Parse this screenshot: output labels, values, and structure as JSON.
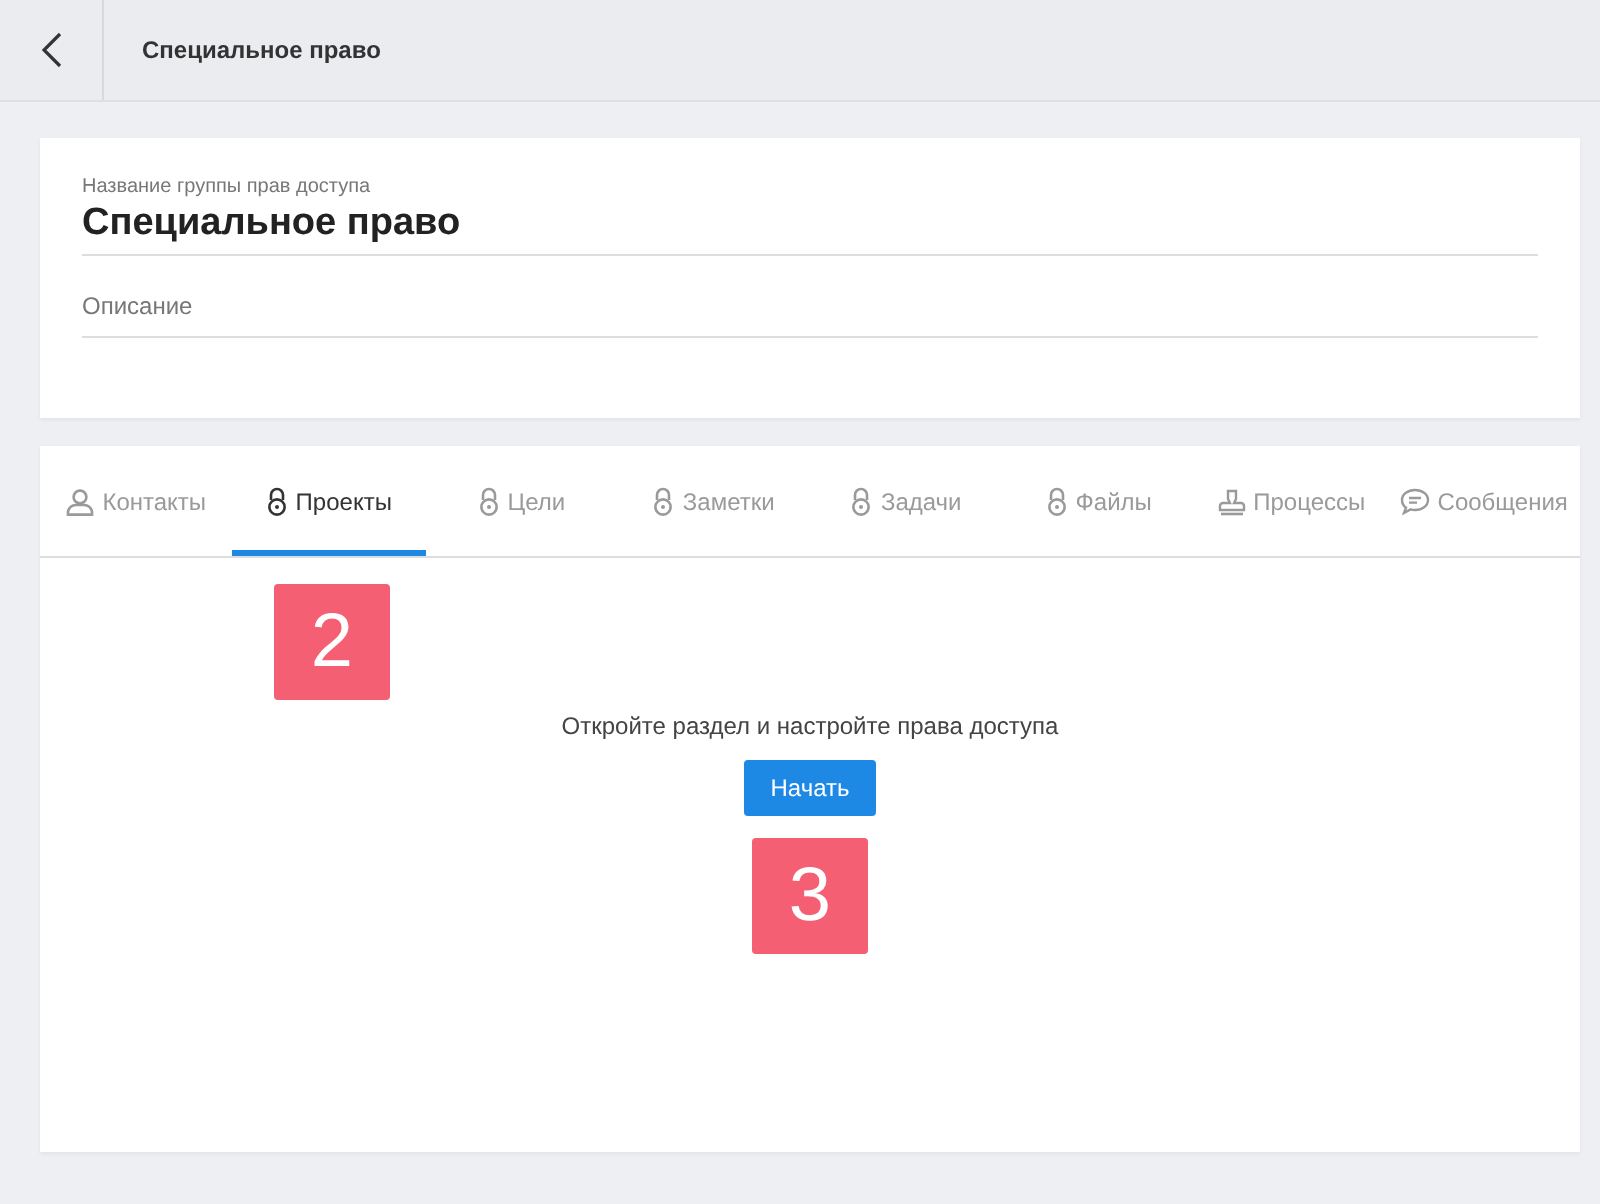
{
  "header": {
    "title": "Специальное право"
  },
  "form": {
    "name_label": "Название группы прав доступа",
    "name_value": "Специальное право",
    "description_placeholder": "Описание"
  },
  "tabs": [
    {
      "label": "Контакты",
      "kind": "person",
      "selected": false
    },
    {
      "label": "Проекты",
      "kind": "lock",
      "selected": true
    },
    {
      "label": "Цели",
      "kind": "lock",
      "selected": false
    },
    {
      "label": "Заметки",
      "kind": "lock",
      "selected": false
    },
    {
      "label": "Задачи",
      "kind": "lock",
      "selected": false
    },
    {
      "label": "Файлы",
      "kind": "lock",
      "selected": false
    },
    {
      "label": "Процессы",
      "kind": "stamp",
      "selected": false
    },
    {
      "label": "Сообщения",
      "kind": "chat",
      "selected": false
    }
  ],
  "body": {
    "message": "Откройте раздел и настройте права доступа",
    "button": "Начать"
  },
  "callouts": [
    "2",
    "3"
  ]
}
